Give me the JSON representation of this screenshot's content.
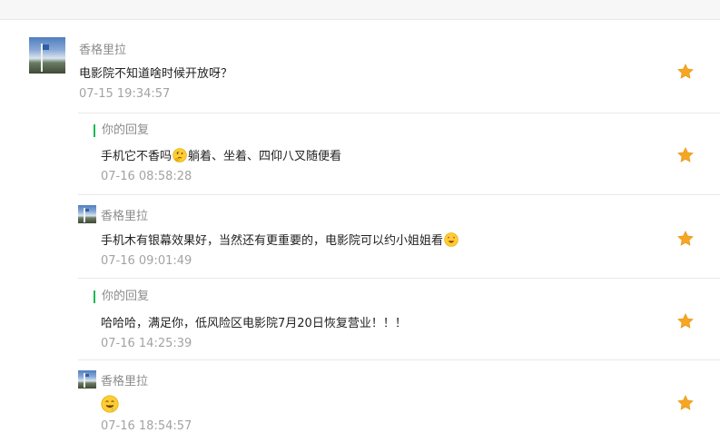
{
  "comment": {
    "author": "香格里拉",
    "text": "电影院不知道啥时候开放呀？",
    "time": "07-15 19:34:57"
  },
  "replies": [
    {
      "author": "你的回复",
      "text_before": "手机它不香吗",
      "emoji": "thinking-face-icon",
      "text_after": "躺着、坐着、四仰八叉随便看",
      "time": "07-16 08:58:28"
    },
    {
      "author": "香格里拉",
      "text_before": "手机木有银幕效果好，当然还有更重要的，电影院可以约小姐姐看",
      "emoji": "heart-eyes-icon",
      "text_after": "",
      "time": "07-16 09:01:49"
    },
    {
      "author": "你的回复",
      "text_before": "哈哈哈，满足你，低风险区电影院7月20日恢复营业！！！",
      "emoji": "",
      "text_after": "",
      "time": "07-16 14:25:39"
    },
    {
      "author": "香格里拉",
      "text_before": "",
      "emoji": "drooling-face-icon",
      "text_after": "",
      "time": "07-16 18:54:57"
    }
  ],
  "colors": {
    "star": "#f5a623",
    "reply_marker": "#19b955",
    "name": "#8c8c8c",
    "time": "#a3a3a3",
    "text": "#222222"
  }
}
